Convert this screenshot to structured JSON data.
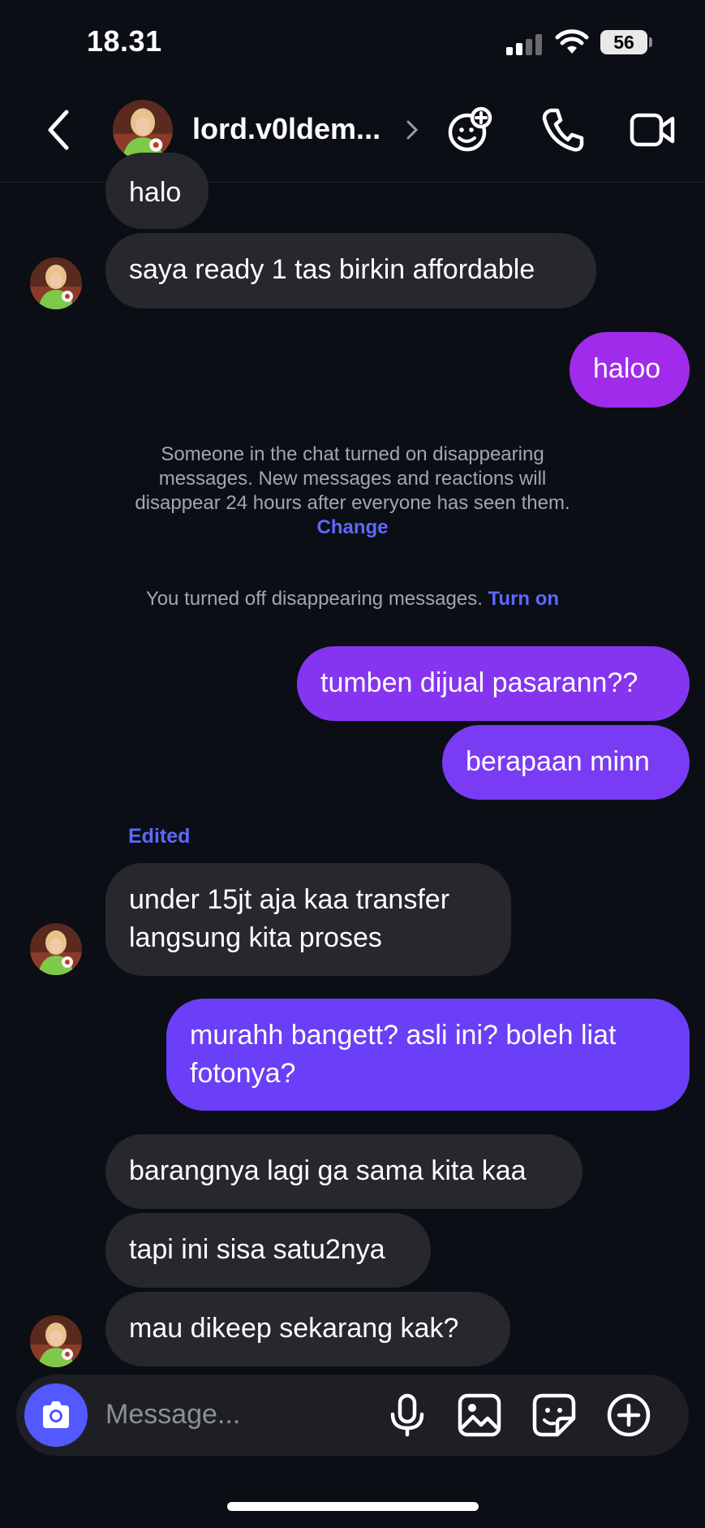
{
  "status_bar": {
    "time": "18.31",
    "battery": "56"
  },
  "header": {
    "username": "lord.v0ldem...",
    "icons": [
      "back-chevron-icon",
      "chevron-right-icon",
      "effects-sticker-icon",
      "phone-icon",
      "video-camera-icon"
    ]
  },
  "messages": [
    {
      "side": "in",
      "text": "halo"
    },
    {
      "side": "in",
      "text": "saya ready 1 tas birkin affordable"
    },
    {
      "side": "out",
      "text": "haloo"
    },
    {
      "side": "out",
      "text": "tumben dijual pasarann??"
    },
    {
      "side": "out",
      "text": "berapaan minn"
    },
    {
      "side": "in",
      "text": "under 15jt aja kaa transfer langsung kita proses",
      "lines": [
        "under 15jt aja kaa transfer",
        "langsung kita proses"
      ],
      "label": "Edited"
    },
    {
      "side": "out",
      "text": "murahh bangett? asli ini? boleh liat fotonya?",
      "lines": [
        "murahh bangett? asli ini? boleh liat",
        "fotonya?"
      ]
    },
    {
      "side": "in",
      "text": "barangnya lagi ga sama kita kaa"
    },
    {
      "side": "in",
      "text": "tapi ini sisa satu2nya"
    },
    {
      "side": "in",
      "text": "mau dikeep sekarang kak?"
    }
  ],
  "system": {
    "disappearing_on": [
      "Someone in the chat turned on disappearing",
      "messages. New messages and reactions will",
      "disappear 24 hours after everyone has seen them."
    ],
    "change_link": "Change",
    "disappearing_off": "You turned off disappearing messages.",
    "turn_on_link": "Turn on"
  },
  "composer": {
    "placeholder": "Message...",
    "icons": [
      "camera-icon",
      "microphone-icon",
      "gallery-icon",
      "sticker-icon",
      "plus-icon"
    ]
  },
  "colors": {
    "background": "#0b0e14",
    "incoming_bubble": "#26282e",
    "outgoing_magenta": "#a02bea",
    "outgoing_purple": "#7a3bf5",
    "outgoing_indigo": "#6a3ff7",
    "link": "#5c69ff"
  }
}
